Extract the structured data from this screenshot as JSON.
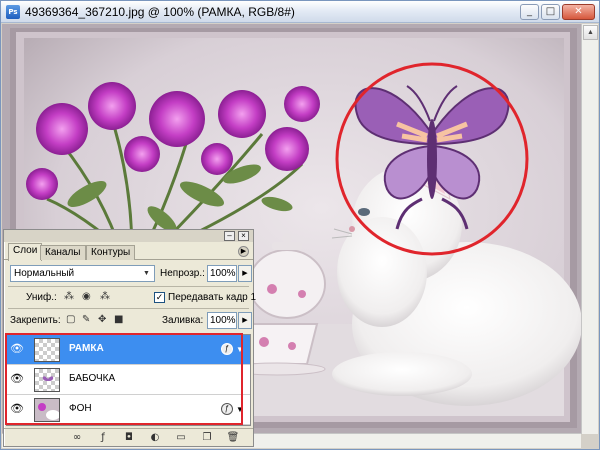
{
  "window": {
    "title": "49369364_367210.jpg @ 100% (РАМКА, RGB/8#)",
    "app_icon": "Ps",
    "minimize": "_",
    "maximize": "□",
    "close": "✕"
  },
  "annotation": {
    "highlight_color": "#e0252c"
  },
  "layers_panel": {
    "tabs": [
      "Слои",
      "Каналы",
      "Контуры"
    ],
    "active_tab": 0,
    "blend_mode": "Нормальный",
    "opacity_label": "Непрозр.:",
    "opacity_value": "100%",
    "unify_label": "Униф.:",
    "propagate_label": "Передавать кадр 1",
    "propagate_checked": "✓",
    "lock_label": "Закрепить:",
    "fill_label": "Заливка:",
    "fill_value": "100%",
    "layers": [
      {
        "name": "РАМКА",
        "selected": true,
        "has_fx": true
      },
      {
        "name": "БАБОЧКА",
        "selected": false,
        "has_fx": false
      },
      {
        "name": "ФОН",
        "selected": false,
        "has_fx": true
      }
    ],
    "accent_color": "#3d8ef0"
  }
}
